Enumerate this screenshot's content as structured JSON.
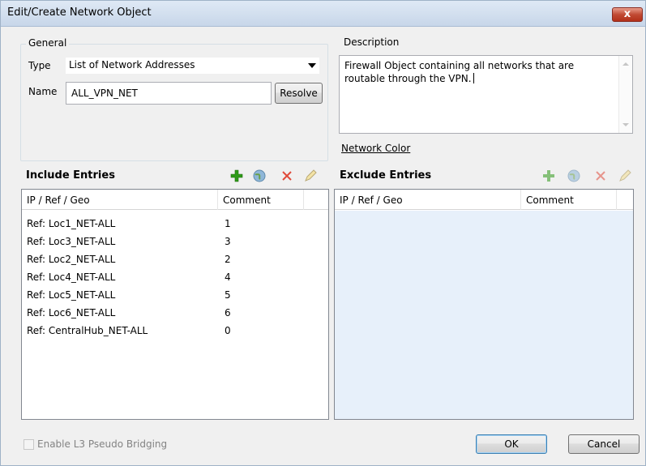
{
  "window": {
    "title": "Edit/Create Network Object",
    "close_label": "x"
  },
  "general": {
    "group_label": "General",
    "type_label": "Type",
    "type_value": "List of Network Addresses",
    "name_label": "Name",
    "name_value": "ALL_VPN_NET",
    "resolve_label": "Resolve"
  },
  "description": {
    "group_label": "Description",
    "text": "Firewall Object containing all networks that are routable through the VPN.",
    "network_color_link": "Network Color"
  },
  "include": {
    "title": "Include Entries",
    "columns": [
      "IP / Ref / Geo",
      "Comment"
    ],
    "rows": [
      {
        "ref": "Ref: Loc1_NET-ALL",
        "comment": "1"
      },
      {
        "ref": "Ref: Loc3_NET-ALL",
        "comment": "3"
      },
      {
        "ref": "Ref: Loc2_NET-ALL",
        "comment": "2"
      },
      {
        "ref": "Ref: Loc4_NET-ALL",
        "comment": "4"
      },
      {
        "ref": "Ref: Loc5_NET-ALL",
        "comment": "5"
      },
      {
        "ref": "Ref: Loc6_NET-ALL",
        "comment": "6"
      },
      {
        "ref": "Ref: CentralHub_NET-ALL",
        "comment": "0"
      }
    ]
  },
  "exclude": {
    "title": "Exclude Entries",
    "columns": [
      "IP / Ref / Geo",
      "Comment"
    ],
    "rows": []
  },
  "footer": {
    "l3_bridging_label": "Enable L3 Pseudo Bridging",
    "ok_label": "OK",
    "cancel_label": "Cancel"
  },
  "icons": {
    "add": "plus-icon",
    "resolve_entry": "globe-icon",
    "remove": "delete-x-icon",
    "edit": "pencil-icon"
  },
  "colors": {
    "title_bar": "#c7d6e9",
    "close_button": "#c14a33",
    "add_icon": "#2e9a18",
    "remove_icon": "#e04a3a",
    "exclude_list_bg": "#e7f0fa"
  }
}
